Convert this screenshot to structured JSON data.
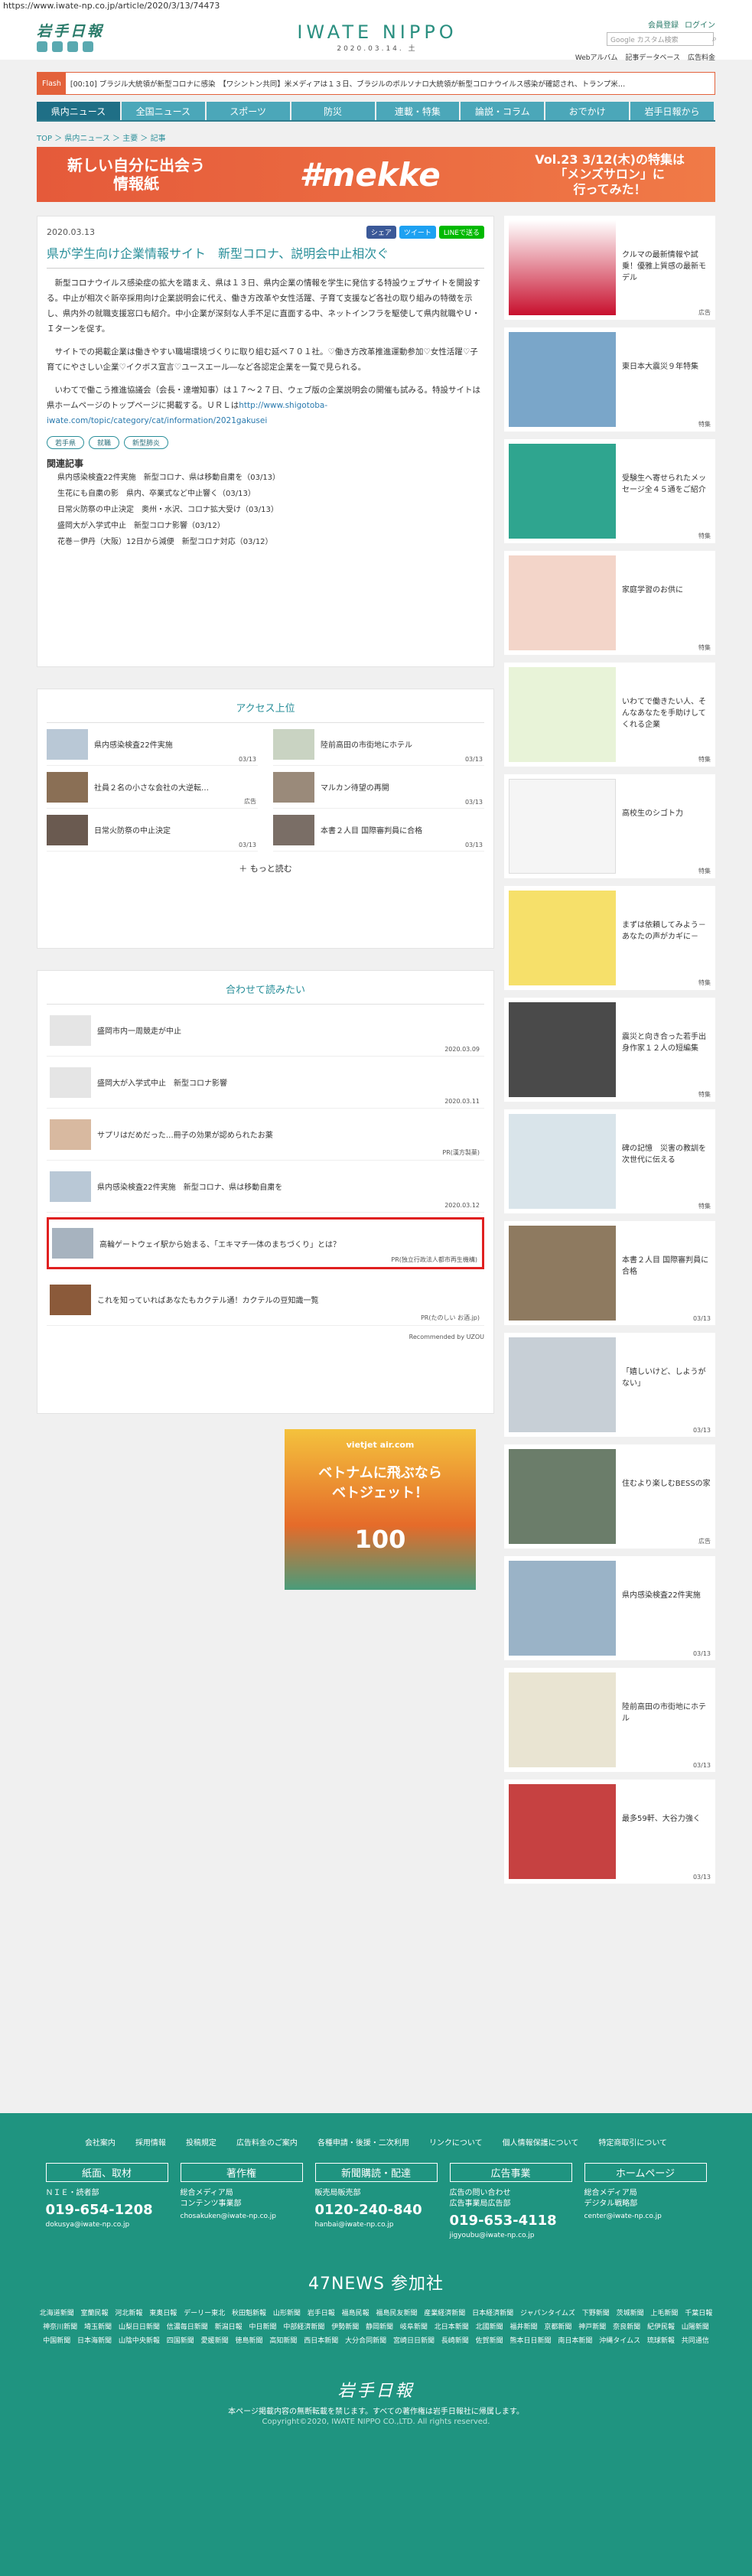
{
  "url": "https://www.iwate-np.co.jp/article/2020/3/13/74473",
  "header": {
    "logo_left": "岩手日報",
    "logo_center": "IWATE NIPPO",
    "date": "2020.03.14. 土",
    "register": "会員登録",
    "login": "ログイン",
    "search_placeholder": "Google カスタム検索",
    "sublinks": [
      "Webアルバム",
      "記事データベース",
      "広告料金"
    ]
  },
  "flash": {
    "label": "Flash",
    "text": "[00:10] ブラジル大統領が新型コロナに感染　【ワシントン共同】米メディアは１３日、ブラジルのボルソナロ大統領が新型コロナウイルス感染が確認され、トランプ米…"
  },
  "nav": [
    "県内ニュース",
    "全国ニュース",
    "スポーツ",
    "防災",
    "連載・特集",
    "論説・コラム",
    "おでかけ",
    "岩手日報から"
  ],
  "breadcrumb": "TOP ＞ 県内ニュース ＞ 主要 ＞ 記事",
  "banner": {
    "left": "新しい自分に出会う\n情報紙",
    "center": "#mekke",
    "right": "Vol.23 3/12(木)の特集は\n「メンズサロン」に\n行ってみた！"
  },
  "article": {
    "date": "2020.03.13",
    "title": "県が学生向け企業情報サイト　新型コロナ、説明会中止相次ぐ",
    "share": [
      "シェア",
      "ツイート",
      "LINEで送る"
    ],
    "p1": "新型コロナウイルス感染症の拡大を踏まえ、県は１３日、県内企業の情報を学生に発信する特設ウェブサイトを開設する。中止が相次ぐ新卒採用向け企業説明会に代え、働き方改革や女性活躍、子育て支援など各社の取り組みの特徴を示し、県内外の就職支援窓口も紹介。中小企業が深刻な人手不足に直面する中、ネットインフラを駆使して県内就職やＵ・Ｉターンを促す。",
    "p2a": "サイトでの掲載企業は働きやすい職場環境づくりに取り組む延べ７０１社。♡働き方改革推進運動参加♡女性活躍♡子育てにやさしい企業♡イクボス宣言♡ユースエール―など各認定企業を一覧で見られる。",
    "p3a": "いわてで働こう推進協議会（会長・達増知事）は１７～２７日、ウェブ版の企業説明会の開催も試みる。特設サイトは県ホームページのトップページに掲載する。ＵＲＬは",
    "p3link": "http://www.shigotoba-iwate.com/topic/category/cat/information/2021gakusei",
    "tags": [
      "若手県",
      "就職",
      "新型肺炎"
    ],
    "related_title": "関連記事",
    "related": [
      "県内感染検査22件実施　新型コロナ、県は移動自粛を（03/13）",
      "生花にも自粛の影　県内、卒業式など中止響く（03/13）",
      "日常火防祭の中止決定　奥州・水沢、コロナ拡大受け（03/13）",
      "盛岡大が入学式中止　新型コロナ影響（03/12）",
      "花巻－伊丹（大阪）12日から減便　新型コロナ対応（03/12）"
    ]
  },
  "access": {
    "title": "アクセス上位",
    "items": [
      {
        "t": "県内感染検査22件実施",
        "d": "03/13"
      },
      {
        "t": "陸前高田の市街地にホテル",
        "d": "03/13"
      },
      {
        "t": "社員２名の小さな会社の大逆転…",
        "d": "広告"
      },
      {
        "t": "マルカン待望の再開",
        "d": "03/13"
      },
      {
        "t": "日常火防祭の中止決定",
        "d": "03/13"
      },
      {
        "t": "本書２人目 国際審判員に合格",
        "d": "03/13"
      }
    ],
    "more": "もっと読む"
  },
  "recommend": {
    "title": "合わせて読みたい",
    "items": [
      {
        "t": "盛岡市内一周競走が中止",
        "d": "2020.03.09"
      },
      {
        "t": "盛岡大が入学式中止　新型コロナ影響",
        "d": "2020.03.11"
      },
      {
        "t": "サプリはだめだった…冊子の効果が認められたお薬",
        "d": "PR(漢方製薬)"
      },
      {
        "t": "県内感染検査22件実施　新型コロナ、県は移動自粛を",
        "d": "2020.03.12"
      },
      {
        "t": "高輪ゲートウェイ駅から始まる、「エキマチ一体のまちづくり」とは？",
        "d": "PR(独立行政法人都市再生機構)"
      },
      {
        "t": "これを知っていればあなたもカクテル通！カクテルの豆知識一覧",
        "d": "PR(たのしい お酒.jp)"
      }
    ],
    "powered": "Recommended by UZOU"
  },
  "mid_ad": {
    "brand": "vietjet air.com",
    "copy": "ベトナムに飛ぶなら\nベトジェット！",
    "price": "100"
  },
  "sidebar": [
    {
      "t": "クルマの最新情報や試乗！優雅上質感の最新モデル",
      "l": "広告"
    },
    {
      "t": "東日本大震災９年特集",
      "l": "特集"
    },
    {
      "t": "受験生へ寄せられたメッセージ全４５通をご紹介",
      "l": "特集"
    },
    {
      "t": "家庭学習のお供に",
      "l": "特集"
    },
    {
      "t": "いわてで働きたい人、そんなあなたを手助けしてくれる企業",
      "l": "特集"
    },
    {
      "t": "高校生のシゴト力",
      "l": "特集"
    },
    {
      "t": "まずは依頼してみよう－あなたの声がカギに－",
      "l": "特集"
    },
    {
      "t": "震災と向き合った若手出身作家１２人の短編集",
      "l": "特集"
    },
    {
      "t": "碑の記憶　災害の教訓を次世代に伝える",
      "l": "特集"
    },
    {
      "t": "本書２人目 国際審判員に合格",
      "l": "03/13"
    },
    {
      "t": "「嬉しいけど、しようがない」",
      "l": "03/13"
    },
    {
      "t": "住むより楽しむBESSの家",
      "l": "広告"
    },
    {
      "t": "県内感染検査22件実施",
      "l": "03/13"
    },
    {
      "t": "陸前高田の市街地にホテル",
      "l": "03/13"
    },
    {
      "t": "最多59軒、大谷力強く",
      "l": "03/13"
    }
  ],
  "footer": {
    "links": [
      "会社案内",
      "採用情報",
      "投稿規定",
      "広告料金のご案内",
      "各種申請・後援・二次利用",
      "リンクについて",
      "個人情報保護について",
      "特定商取引について"
    ],
    "cols": [
      {
        "h": "紙面、取材",
        "s": "ＮＩＥ・読者部",
        "p": "019-654-1208",
        "m": "dokusya@iwate-np.co.jp"
      },
      {
        "h": "著作権",
        "s": "総合メディア局\nコンテンツ事業部",
        "p": "",
        "m": "chosakuken@iwate-np.co.jp"
      },
      {
        "h": "新聞購読・配達",
        "s": "販売局販売部",
        "p": "0120-240-840",
        "m": "hanbai@iwate-np.co.jp"
      },
      {
        "h": "広告事業",
        "s": "広告の問い合わせ\n広告事業局広告部",
        "p": "019-653-4118",
        "m": "jigyoubu@iwate-np.co.jp"
      },
      {
        "h": "ホームページ",
        "s": "総合メディア局\nデジタル戦略部",
        "p": "",
        "m": "center@iwate-np.co.jp"
      }
    ],
    "n47": "47NEWS 参加社",
    "papers": "北海道新聞 室蘭民報 河北新報 東奥日報 デーリー東北 秋田魁新報 山形新聞 岩手日報 福島民報 福島民友新聞 産業経済新聞 日本経済新聞 ジャパンタイムズ 下野新聞 茨城新聞 上毛新聞 千葉日報 神奈川新聞 埼玉新聞 山梨日日新聞 信濃毎日新聞 新潟日報 中日新聞 中部経済新聞 伊勢新聞 静岡新聞 岐阜新聞 北日本新聞 北國新聞 福井新聞 京都新聞 神戸新聞 奈良新聞 紀伊民報 山陽新聞 中国新聞 日本海新聞 山陰中央新報 四国新聞 愛媛新聞 徳島新聞 高知新聞 西日本新聞 大分合同新聞 宮崎日日新聞 長崎新聞 佐賀新聞 熊本日日新聞 南日本新聞 沖縄タイムス 琉球新報 共同通信",
    "logo": "岩手日報",
    "note": "本ページ掲載内容の無断転載を禁じます。すべての著作権は岩手日報社に帰属します。",
    "copy": "Copyright©2020, IWATE NIPPO CO.,LTD. All rights reserved."
  }
}
